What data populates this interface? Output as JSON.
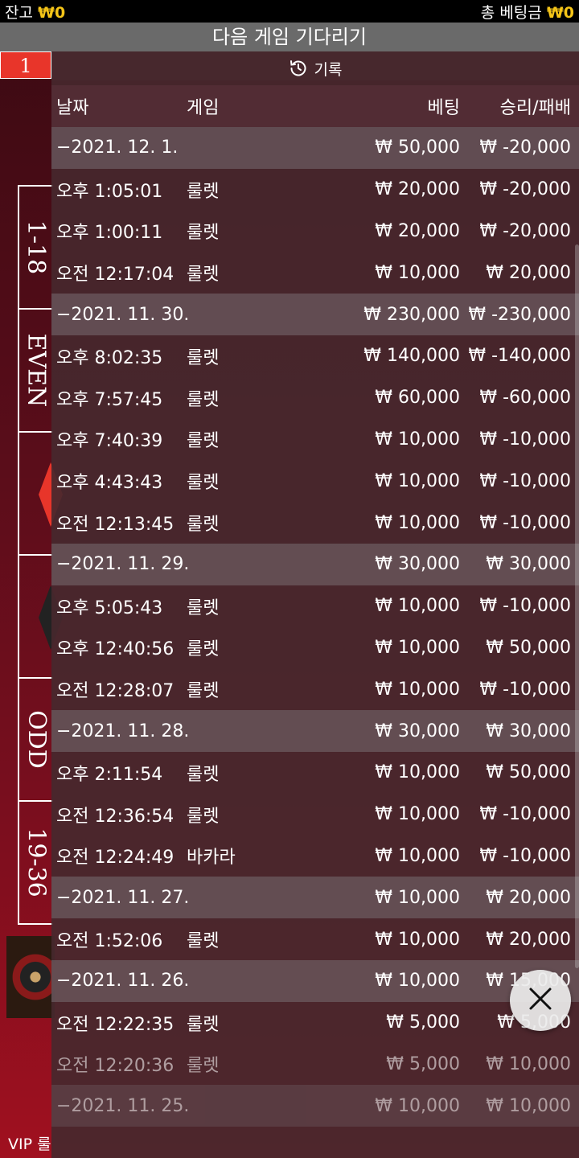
{
  "status": {
    "balance_label": "잔고",
    "balance_value": "₩0",
    "total_bet_label": "총 베팅금",
    "total_bet_value": "₩0"
  },
  "title": "다음 게임 기다리기",
  "background": {
    "badge_number": "1",
    "board_labels": [
      "1-18",
      "EVEN",
      "",
      "",
      "ODD",
      "19-36"
    ],
    "vip_text": "VIP 룰"
  },
  "history": {
    "header_label": "기록",
    "columns": {
      "time": "날짜",
      "game": "게임",
      "bet": "베팅",
      "result": "승리/패배"
    },
    "rows": [
      {
        "type": "date",
        "time": "−2021. 12. 1.",
        "bet": "₩ 50,000",
        "result": "₩ -20,000"
      },
      {
        "type": "item",
        "time": "오후 1:05:01",
        "game": "룰렛",
        "bet": "₩ 20,000",
        "result": "₩ -20,000"
      },
      {
        "type": "item",
        "time": "오후 1:00:11",
        "game": "룰렛",
        "bet": "₩ 20,000",
        "result": "₩ -20,000"
      },
      {
        "type": "item",
        "time": "오전 12:17:04",
        "game": "룰렛",
        "bet": "₩ 10,000",
        "result": "₩ 20,000"
      },
      {
        "type": "date",
        "time": "−2021. 11. 30.",
        "bet": "₩ 230,000",
        "result": "₩ -230,000"
      },
      {
        "type": "item",
        "time": "오후 8:02:35",
        "game": "룰렛",
        "bet": "₩ 140,000",
        "result": "₩ -140,000"
      },
      {
        "type": "item",
        "time": "오후 7:57:45",
        "game": "룰렛",
        "bet": "₩ 60,000",
        "result": "₩ -60,000"
      },
      {
        "type": "item",
        "time": "오후 7:40:39",
        "game": "룰렛",
        "bet": "₩ 10,000",
        "result": "₩ -10,000"
      },
      {
        "type": "item",
        "time": "오후 4:43:43",
        "game": "룰렛",
        "bet": "₩ 10,000",
        "result": "₩ -10,000"
      },
      {
        "type": "item",
        "time": "오전 12:13:45",
        "game": "룰렛",
        "bet": "₩ 10,000",
        "result": "₩ -10,000"
      },
      {
        "type": "date",
        "time": "−2021. 11. 29.",
        "bet": "₩ 30,000",
        "result": "₩ 30,000"
      },
      {
        "type": "item",
        "time": "오후 5:05:43",
        "game": "룰렛",
        "bet": "₩ 10,000",
        "result": "₩ -10,000"
      },
      {
        "type": "item",
        "time": "오후 12:40:56",
        "game": "룰렛",
        "bet": "₩ 10,000",
        "result": "₩ 50,000"
      },
      {
        "type": "item",
        "time": "오전 12:28:07",
        "game": "룰렛",
        "bet": "₩ 10,000",
        "result": "₩ -10,000"
      },
      {
        "type": "date",
        "time": "−2021. 11. 28.",
        "bet": "₩ 30,000",
        "result": "₩ 30,000"
      },
      {
        "type": "item",
        "time": "오후 2:11:54",
        "game": "룰렛",
        "bet": "₩ 10,000",
        "result": "₩ 50,000"
      },
      {
        "type": "item",
        "time": "오전 12:36:54",
        "game": "룰렛",
        "bet": "₩ 10,000",
        "result": "₩ -10,000"
      },
      {
        "type": "item",
        "time": "오전 12:24:49",
        "game": "바카라",
        "bet": "₩ 10,000",
        "result": "₩ -10,000"
      },
      {
        "type": "date",
        "time": "−2021. 11. 27.",
        "bet": "₩ 10,000",
        "result": "₩ 20,000"
      },
      {
        "type": "item",
        "time": "오전 1:52:06",
        "game": "룰렛",
        "bet": "₩ 10,000",
        "result": "₩ 20,000"
      },
      {
        "type": "date",
        "time": "−2021. 11. 26.",
        "bet": "₩ 10,000",
        "result": "₩ 15,000"
      },
      {
        "type": "item",
        "time": "오전 12:22:35",
        "game": "룰렛",
        "bet": "₩ 5,000",
        "result": "₩ 5,000"
      },
      {
        "type": "item",
        "time": "오전 12:20:36",
        "game": "룰렛",
        "bet": "₩ 5,000",
        "result": "₩ 10,000",
        "faded": true
      },
      {
        "type": "date",
        "time": "−2021. 11. 25.",
        "bet": "₩ 10,000",
        "result": "₩ 10,000",
        "faded": true
      }
    ]
  },
  "close_icon": "close-icon",
  "colors": {
    "gold": "#f5c518",
    "panel": "#46282e",
    "badge": "#e8352a"
  }
}
